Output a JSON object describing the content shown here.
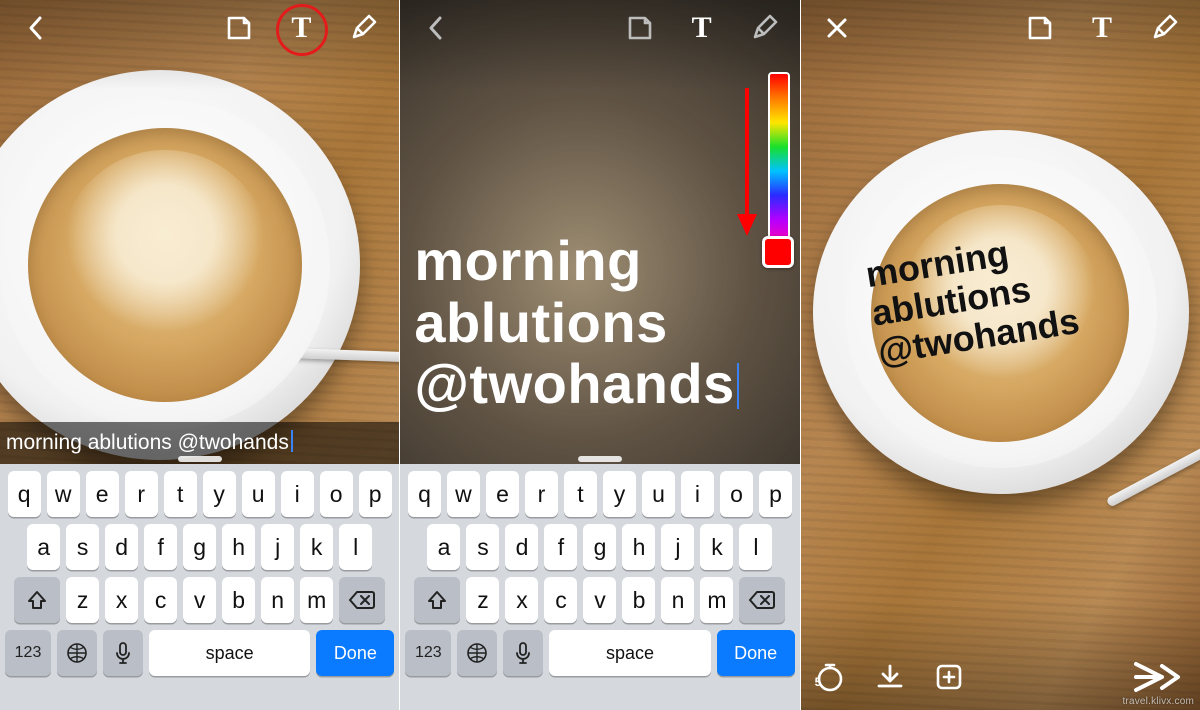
{
  "watermark": "travel.klivx.com",
  "caption_text": "morning ablutions @twohands",
  "big_text_lines": [
    "morning",
    "ablutions",
    "@twohands"
  ],
  "placed_text_lines": [
    "morning",
    "ablutions",
    "@twohands"
  ],
  "keyboard": {
    "row1": [
      "q",
      "w",
      "e",
      "r",
      "t",
      "y",
      "u",
      "i",
      "o",
      "p"
    ],
    "row2": [
      "a",
      "s",
      "d",
      "f",
      "g",
      "h",
      "j",
      "k",
      "l"
    ],
    "row3": [
      "z",
      "x",
      "c",
      "v",
      "b",
      "n",
      "m"
    ],
    "switch_label": "123",
    "space_label": "space",
    "done_label": "Done"
  },
  "icons": {
    "back": "back-icon",
    "close": "close-icon",
    "sticker": "sticker-icon",
    "text": "text-icon",
    "draw": "pencil-icon",
    "timer": "timer-icon",
    "timer_badge": "5",
    "save": "save-down-icon",
    "story": "add-story-icon",
    "send": "send-icon",
    "shift": "shift-icon",
    "backspace": "backspace-icon",
    "globe": "globe-icon",
    "mic": "mic-icon"
  },
  "annotations": {
    "red_circle_on": "text-icon",
    "red_arrow_points_to": "color-slider"
  }
}
